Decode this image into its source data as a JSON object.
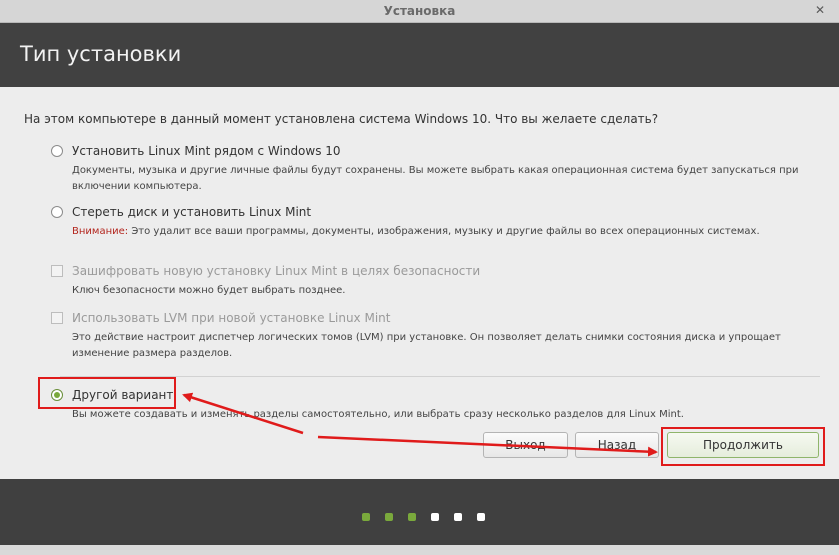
{
  "window": {
    "title": "Установка",
    "close_glyph": "✕"
  },
  "header": {
    "title": "Тип установки"
  },
  "question": "На этом компьютере в данный момент установлена система Windows 10. Что вы желаете сделать?",
  "options": {
    "alongside": {
      "label": "Установить Linux Mint рядом с Windows 10",
      "desc": "Документы, музыка и другие личные файлы будут сохранены. Вы можете выбрать какая операционная система будет запускаться при включении компьютера.",
      "selected": false
    },
    "erase": {
      "label": "Стереть диск и установить Linux Mint",
      "warn_label": "Внимание:",
      "warn_text": " Это удалит все ваши программы, документы, изображения, музыку и другие файлы во всех операционных системах.",
      "selected": false
    },
    "encrypt": {
      "label": "Зашифровать новую установку Linux Mint в целях безопасности",
      "desc": "Ключ безопасности можно будет выбрать позднее.",
      "enabled": false
    },
    "lvm": {
      "label": "Использовать LVM при новой установке Linux Mint",
      "desc": "Это действие настроит диспетчер логических томов (LVM) при установке. Он позволяет делать снимки состояния диска и упрощает изменение размера разделов.",
      "enabled": false
    },
    "other": {
      "label": "Другой вариант",
      "desc": "Вы можете создавать и изменять разделы самостоятельно, или выбрать сразу несколько разделов для Linux Mint.",
      "selected": true
    }
  },
  "buttons": {
    "quit": "Выход",
    "back": "Назад",
    "continue": "Продолжить"
  },
  "progress": {
    "total_steps": 6,
    "completed_steps": 3
  },
  "colors": {
    "accent_green": "#7aa93c",
    "highlight_red": "#e01b1b"
  }
}
